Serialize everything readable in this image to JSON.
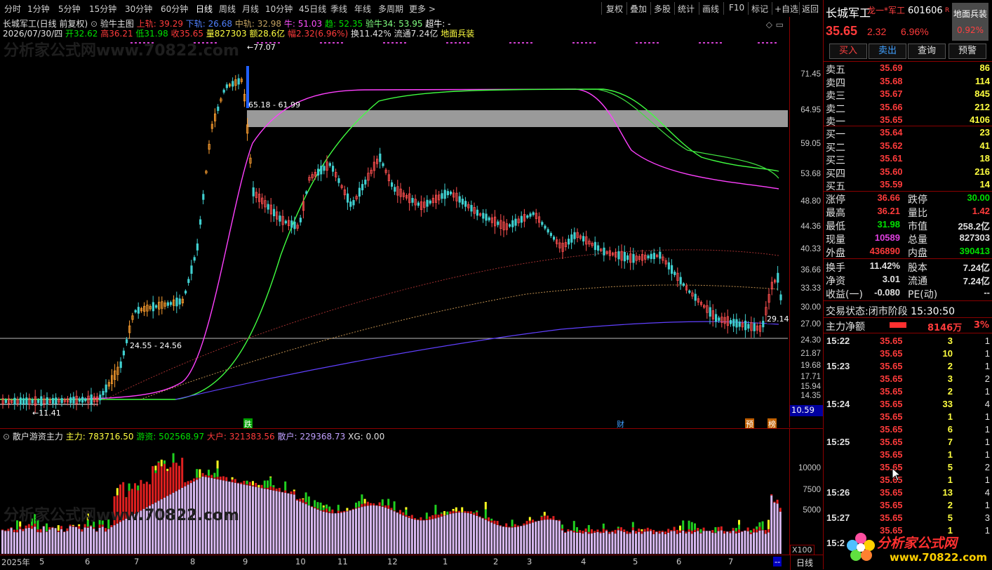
{
  "toolbar": {
    "periods": [
      "分时",
      "1分钟",
      "5分钟",
      "15分钟",
      "30分钟",
      "60分钟",
      "日线",
      "周线",
      "月线",
      "10分钟",
      "45日线",
      "季线",
      "年线",
      "多周期",
      "更多 >"
    ],
    "active_period": "日线",
    "actions": [
      "复权",
      "叠加",
      "多股",
      "统计",
      "画线",
      "F10",
      "标记",
      "+自选",
      "返回"
    ]
  },
  "chart_header": {
    "line1_name": "长城军工(日线 前复权)",
    "line1_indicator": "验牛主图",
    "upper_label": "上轨: 39.29",
    "lower_label": "下轨: 26.68",
    "mid_label": "中轨: 32.98",
    "bull_label": "牛: 51.03",
    "trend_label": "趋: 52.35",
    "verify_label": "验牛34: 53.95",
    "super_label": "超牛: -",
    "line2_date": "2026/07/30/四",
    "open": "开32.62",
    "high": "高36.21",
    "low": "低31.98",
    "close": "收35.65",
    "volume": "量827303",
    "amount": "额28.6亿",
    "change": "幅2.32(6.96%)",
    "turnover": "换11.42%",
    "float_value": "流通7.24亿",
    "location": "地面兵装"
  },
  "chart_annotations": {
    "peak": "←77.07",
    "gap_label": "65.18 - 61.99",
    "support_label": "24.55 - 24.56",
    "bottom_label": "←11.41",
    "current_tag": "29.14",
    "y_side_price": "10.59",
    "marker_die": "跌",
    "marker_cai": "财",
    "marker_yu": "预",
    "marker_bang": "榜"
  },
  "price_axis": [
    "71.45",
    "64.95",
    "59.05",
    "53.68",
    "48.80",
    "44.36",
    "40.33",
    "36.66",
    "33.33",
    "30.00",
    "27.00",
    "24.30",
    "21.87",
    "19.68",
    "17.71",
    "15.94",
    "14.35"
  ],
  "sub_header": {
    "name": "散户游资主力",
    "main": "主力: 783716.50",
    "hot": "游资: 502568.97",
    "big": "大户: 321383.56",
    "retail": "散户: 229368.73",
    "xg": "XG: 0.00"
  },
  "sub_axis": [
    "10000",
    "7500",
    "5000"
  ],
  "sub_axis_unit": "X100",
  "date_axis": [
    "2025年",
    "5",
    "6",
    "7",
    "8",
    "9",
    "10",
    "11",
    "12",
    "1",
    "2",
    "3",
    "4",
    "5",
    "6",
    "7"
  ],
  "date_axis_end": "--",
  "period_label": "日线",
  "quote": {
    "name": "长城军工",
    "sector": "龙一*军工",
    "code": "601606",
    "price": "35.65",
    "change": "2.32",
    "change_pct": "6.96%",
    "industry_btn": "地面兵装",
    "industry_pct": "0.92%",
    "buttons": [
      "买入",
      "卖出",
      "查询",
      "预警"
    ]
  },
  "order_book": {
    "asks": [
      {
        "label": "卖五",
        "price": "35.69",
        "vol": "86"
      },
      {
        "label": "卖四",
        "price": "35.68",
        "vol": "114"
      },
      {
        "label": "卖三",
        "price": "35.67",
        "vol": "845"
      },
      {
        "label": "卖二",
        "price": "35.66",
        "vol": "212"
      },
      {
        "label": "卖一",
        "price": "35.65",
        "vol": "4106"
      }
    ],
    "bids": [
      {
        "label": "买一",
        "price": "35.64",
        "vol": "23"
      },
      {
        "label": "买二",
        "price": "35.62",
        "vol": "41"
      },
      {
        "label": "买三",
        "price": "35.61",
        "vol": "18"
      },
      {
        "label": "买四",
        "price": "35.60",
        "vol": "216"
      },
      {
        "label": "买五",
        "price": "35.59",
        "vol": "14"
      }
    ]
  },
  "stats": [
    {
      "l1": "涨停",
      "v1": "36.66",
      "l2": "跌停",
      "v2": "30.00"
    },
    {
      "l1": "最高",
      "v1": "36.21",
      "l2": "量比",
      "v2": "1.42"
    },
    {
      "l1": "最低",
      "v1": "31.98",
      "l2": "市值",
      "v2": "258.2亿"
    },
    {
      "l1": "现量",
      "v1": "10589",
      "l2": "总量",
      "v2": "827303"
    },
    {
      "l1": "外盘",
      "v1": "436890",
      "l2": "内盘",
      "v2": "390413"
    }
  ],
  "stats2": [
    {
      "l1": "换手",
      "v1": "11.42%",
      "l2": "股本",
      "v2": "7.24亿"
    },
    {
      "l1": "净资",
      "v1": "3.01",
      "l2": "流通",
      "v2": "7.24亿"
    },
    {
      "l1": "收益(一)",
      "v1": "-0.080",
      "l2": "PE(动)",
      "v2": "--"
    }
  ],
  "trade_status": {
    "label": "交易状态:",
    "status": "闭市阶段",
    "time": "15:30:50"
  },
  "main_flow": {
    "label": "主力净额",
    "value": "8146万",
    "pct": "3%"
  },
  "ticks": [
    {
      "time": "15:22",
      "price": "35.65",
      "vol": "3",
      "n": "1"
    },
    {
      "time": "",
      "price": "35.65",
      "vol": "10",
      "n": "1"
    },
    {
      "time": "15:23",
      "price": "35.65",
      "vol": "2",
      "n": "1"
    },
    {
      "time": "",
      "price": "35.65",
      "vol": "3",
      "n": "2"
    },
    {
      "time": "",
      "price": "35.65",
      "vol": "2",
      "n": "1"
    },
    {
      "time": "15:24",
      "price": "35.65",
      "vol": "33",
      "n": "4"
    },
    {
      "time": "",
      "price": "35.65",
      "vol": "1",
      "n": "1"
    },
    {
      "time": "",
      "price": "35.65",
      "vol": "6",
      "n": "1"
    },
    {
      "time": "15:25",
      "price": "35.65",
      "vol": "7",
      "n": "1"
    },
    {
      "time": "",
      "price": "35.65",
      "vol": "1",
      "n": "1"
    },
    {
      "time": "",
      "price": "35.65",
      "vol": "5",
      "n": "2"
    },
    {
      "time": "",
      "price": "35.65",
      "vol": "1",
      "n": "1"
    },
    {
      "time": "15:26",
      "price": "35.65",
      "vol": "13",
      "n": "4"
    },
    {
      "time": "",
      "price": "35.65",
      "vol": "2",
      "n": "1"
    },
    {
      "time": "15:27",
      "price": "35.65",
      "vol": "5",
      "n": "3"
    },
    {
      "time": "",
      "price": "35.65",
      "vol": "1",
      "n": "1"
    },
    {
      "time": "15:2",
      "price": "",
      "vol": "",
      "n": ""
    }
  ],
  "watermark": "分析家公式网",
  "watermark_url": "www.70822.com"
}
